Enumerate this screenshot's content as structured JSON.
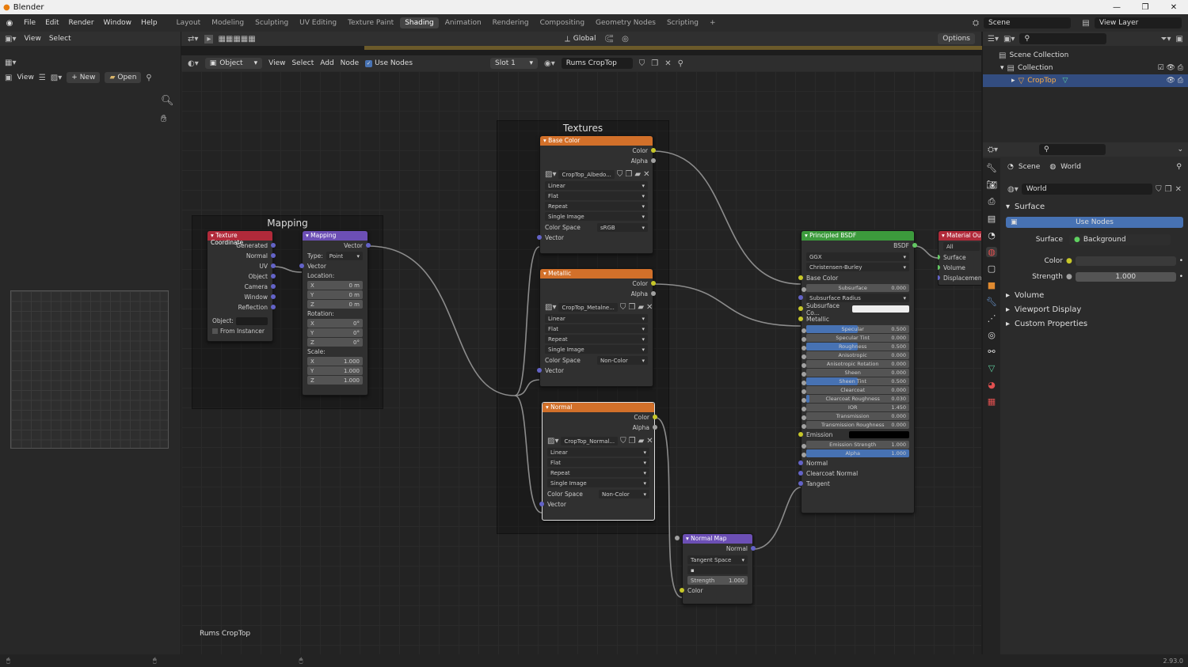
{
  "title_bar": {
    "app": "Blender"
  },
  "menu": [
    "File",
    "Edit",
    "Render",
    "Window",
    "Help"
  ],
  "workspaces": [
    {
      "label": "Layout"
    },
    {
      "label": "Modeling"
    },
    {
      "label": "Sculpting"
    },
    {
      "label": "UV Editing"
    },
    {
      "label": "Texture Paint"
    },
    {
      "label": "Shading",
      "active": true
    },
    {
      "label": "Animation"
    },
    {
      "label": "Rendering"
    },
    {
      "label": "Compositing"
    },
    {
      "label": "Geometry Nodes"
    },
    {
      "label": "Scripting"
    }
  ],
  "scene": {
    "name": "Scene",
    "view_layer": "View Layer"
  },
  "viewport_header": {
    "view": "View",
    "select": "Select",
    "orientation": "Global",
    "options": "Options"
  },
  "image_editor": {
    "view": "View",
    "new": "New",
    "open": "Open"
  },
  "node_header": {
    "object": "Object",
    "view": "View",
    "select": "Select",
    "add": "Add",
    "node": "Node",
    "use_nodes": "Use Nodes",
    "slot": "Slot 1",
    "material": "Rums CropTop"
  },
  "node_editor": {
    "material_label": "Rums CropTop"
  },
  "frames": {
    "mapping": "Mapping",
    "textures": "Textures"
  },
  "texture_coordinate": {
    "title": "Texture Coordinate",
    "outputs": [
      "Generated",
      "Normal",
      "UV",
      "Object",
      "Camera",
      "Window",
      "Reflection"
    ],
    "object_label": "Object:",
    "from_instancer": "From Instancer"
  },
  "mapping": {
    "title": "Mapping",
    "vector_out": "Vector",
    "type_label": "Type:",
    "type": "Point",
    "vector_in": "Vector",
    "location_label": "Location:",
    "location": [
      "0 m",
      "0 m",
      "0 m"
    ],
    "rotation_label": "Rotation:",
    "rotation": [
      "0°",
      "0°",
      "0°"
    ],
    "scale_label": "Scale:",
    "scale": [
      "1.000",
      "1.000",
      "1.000"
    ],
    "axes": [
      "X",
      "Y",
      "Z"
    ]
  },
  "tex_base": {
    "title": "Base Color",
    "color": "Color",
    "alpha": "Alpha",
    "image": "CropTop_Albedo...",
    "interp": "Linear",
    "proj": "Flat",
    "ext": "Repeat",
    "source": "Single Image",
    "cs_label": "Color Space",
    "cs": "sRGB",
    "vector": "Vector"
  },
  "tex_metal": {
    "title": "Metallic",
    "color": "Color",
    "alpha": "Alpha",
    "image": "CropTop_Metalne...",
    "interp": "Linear",
    "proj": "Flat",
    "ext": "Repeat",
    "source": "Single Image",
    "cs_label": "Color Space",
    "cs": "Non-Color",
    "vector": "Vector"
  },
  "tex_normal": {
    "title": "Normal",
    "color": "Color",
    "alpha": "Alpha",
    "image": "CropTop_Normal...",
    "interp": "Linear",
    "proj": "Flat",
    "ext": "Repeat",
    "source": "Single Image",
    "cs_label": "Color Space",
    "cs": "Non-Color",
    "vector": "Vector"
  },
  "normal_map": {
    "title": "Normal Map",
    "normal": "Normal",
    "space": "Tangent Space",
    "strength_label": "Strength",
    "strength": "1.000",
    "color": "Color"
  },
  "bsdf": {
    "title": "Principled BSDF",
    "out": "BSDF",
    "dist": "GGX",
    "sss": "Christensen-Burley",
    "base_color": "Base Color",
    "rows": [
      {
        "label": "Subsurface",
        "value": "0.000",
        "fill": 0
      },
      {
        "label": "Subsurface Radius",
        "value": "",
        "fill": 0,
        "dd": true
      },
      {
        "label": "Subsurface Co...",
        "value": "",
        "color": true
      },
      {
        "label": "Metallic",
        "value": "",
        "plain": true
      },
      {
        "label": "Specular",
        "value": "0.500",
        "fill": 0.5
      },
      {
        "label": "Specular Tint",
        "value": "0.000",
        "fill": 0
      },
      {
        "label": "Roughness",
        "value": "0.500",
        "fill": 0.5
      },
      {
        "label": "Anisotropic",
        "value": "0.000",
        "fill": 0
      },
      {
        "label": "Anisotropic Rotation",
        "value": "0.000",
        "fill": 0
      },
      {
        "label": "Sheen",
        "value": "0.000",
        "fill": 0
      },
      {
        "label": "Sheen Tint",
        "value": "0.500",
        "fill": 0.5
      },
      {
        "label": "Clearcoat",
        "value": "0.000",
        "fill": 0
      },
      {
        "label": "Clearcoat Roughness",
        "value": "0.030",
        "fill": 0.03
      },
      {
        "label": "IOR",
        "value": "1.450",
        "fill": 0
      },
      {
        "label": "Transmission",
        "value": "0.000",
        "fill": 0
      },
      {
        "label": "Transmission Roughness",
        "value": "0.000",
        "fill": 0
      },
      {
        "label": "Emission",
        "value": "",
        "black": true
      },
      {
        "label": "Emission Strength",
        "value": "1.000",
        "fill": 0
      },
      {
        "label": "Alpha",
        "value": "1.000",
        "fill": 1.0
      }
    ],
    "tail": [
      "Normal",
      "Clearcoat Normal",
      "Tangent"
    ]
  },
  "material_output": {
    "title": "Material Outp",
    "target": "All",
    "inputs": [
      "Surface",
      "Volume",
      "Displacement"
    ]
  },
  "outliner": {
    "root": "Scene Collection",
    "collection": "Collection",
    "object": "CropTop"
  },
  "properties": {
    "breadcrumb_scene": "Scene",
    "breadcrumb_world": "World",
    "world_name": "World",
    "surface_panel": "Surface",
    "use_nodes": "Use Nodes",
    "surface_label": "Surface",
    "surface_value": "Background",
    "color_label": "Color",
    "strength_label": "Strength",
    "strength_value": "1.000",
    "panels": [
      "Volume",
      "Viewport Display",
      "Custom Properties"
    ]
  },
  "status": {
    "version": "2.93.0"
  },
  "colors": {
    "accent": "#4772b3",
    "tex_header": "#d2702a",
    "vector_header": "#6c4fb5",
    "input_header": "#b12a3a",
    "shader_header": "#3c9a3c"
  }
}
